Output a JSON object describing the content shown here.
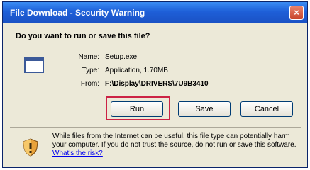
{
  "dialog": {
    "title": "File Download - Security Warning",
    "close_label": "×",
    "question": "Do you want to run or save this file?",
    "file": {
      "name_label": "Name:",
      "name_value": "Setup.exe",
      "type_label": "Type:",
      "type_value": "Application, 1.70MB",
      "from_label": "From:",
      "from_value": "F:\\Display\\DRIVERS\\7U9B3410"
    },
    "buttons": {
      "run": "Run",
      "save": "Save",
      "cancel": "Cancel"
    },
    "warning": {
      "text": "While files from the Internet can be useful, this file type can potentially harm your computer. If you do not trust the source, do not run or save this software. ",
      "link": "What's the risk?"
    }
  },
  "colors": {
    "titlebar": "#1e5fd8",
    "highlight": "#cc2244",
    "dialog_bg": "#ece9d8"
  },
  "icons": [
    "close-icon",
    "file-icon",
    "shield-warning-icon"
  ]
}
